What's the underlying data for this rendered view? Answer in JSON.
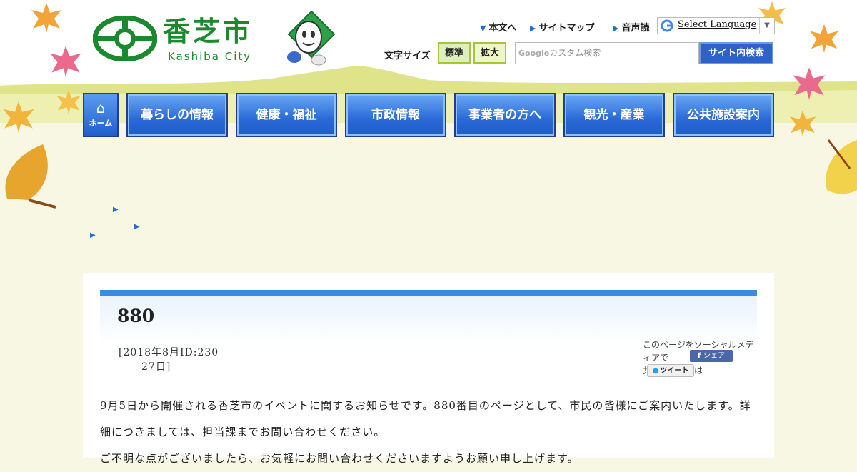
{
  "header": {
    "logo_text": "香芝市",
    "logo_subtext": "Kashiba City"
  },
  "top_links": [
    {
      "label": "本文へ"
    },
    {
      "label": "サイトマップ"
    },
    {
      "label": "音声読"
    }
  ],
  "language": {
    "label": "Select Language"
  },
  "font_size": {
    "label": "文字サイズ",
    "standard": "標準",
    "large": "拡大"
  },
  "search": {
    "placeholder_brand": "Google",
    "placeholder": "カスタム検索",
    "button": "サイト内検索"
  },
  "nav": {
    "home": "ホーム",
    "items": [
      "暮らしの情報",
      "健康・福祉",
      "市政情報",
      "事業者の方へ",
      "観光・産業",
      "公共施設案内"
    ]
  },
  "page": {
    "title": "880",
    "date": "[2018年8月ID:23027日]",
    "date_line1": "[2018年8月ID:230",
    "date_line2": "27日]",
    "social_text_1": "このページをソーシャルメディアで",
    "social_text_2": "共有する場合は",
    "share_button": "シェア",
    "tweet_button": "ツイート",
    "body_line1": "9月5日から開催される香芝市のイベントに関するお知らせです。880番目のページとして、市民の皆様にご案内いたします。詳細につきましては、担当課までお問い合わせください。",
    "body_line2": "ご不明な点がございましたら、お気軽にお問い合わせくださいますようお願い申し上げます。"
  },
  "colors": {
    "brand_green": "#1b8a2e",
    "nav_blue": "#2a6ad6",
    "title_accent": "#3a8be0"
  }
}
